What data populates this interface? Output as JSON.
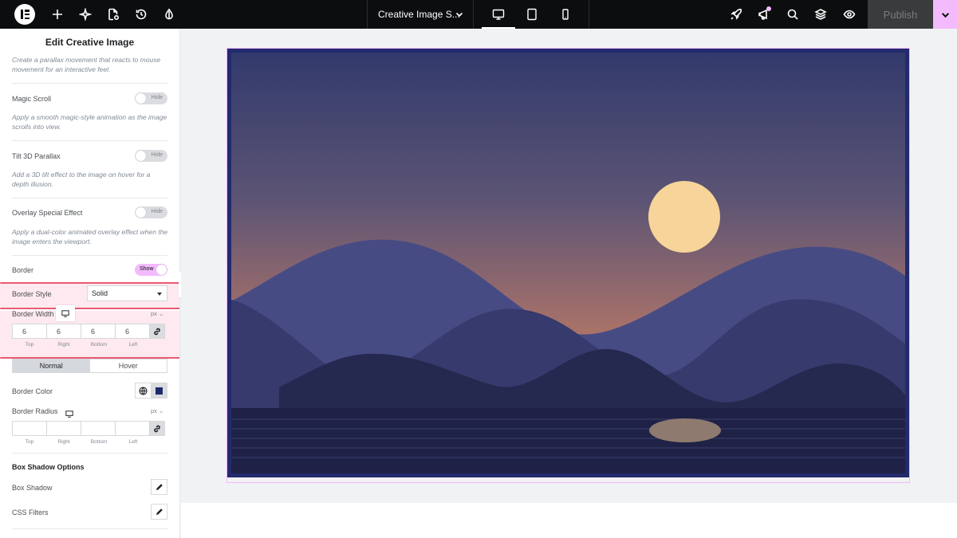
{
  "topbar": {
    "document_title": "Creative Image S...",
    "publish_label": "Publish",
    "left_icons": [
      "elementor-logo-icon",
      "add-icon",
      "ai-sparkle-icon",
      "page-settings-icon",
      "history-icon",
      "site-style-icon"
    ],
    "devices": [
      "desktop-icon",
      "tablet-icon",
      "mobile-icon"
    ],
    "active_device": "desktop",
    "right_icons": [
      "rocket-icon",
      "announcements-icon",
      "search-icon",
      "structure-layers-icon",
      "preview-eye-icon"
    ]
  },
  "panel": {
    "title": "Edit Creative Image",
    "top_desc": "Create a parallax movement that reacts to mouse movement for an interactive feel.",
    "magic_scroll": {
      "label": "Magic Scroll",
      "toggle": "Hide",
      "desc": "Apply a smooth magic-style animation as the image scrolls into view."
    },
    "tilt": {
      "label": "Tilt 3D Parallax",
      "toggle": "Hide",
      "desc": "Add a 3D tilt effect to the image on hover for a depth illusion."
    },
    "overlay": {
      "label": "Overlay Special Effect",
      "toggle": "Hide",
      "desc": "Apply a dual-color animated overlay effect when the image enters the viewport."
    },
    "border": {
      "label": "Border",
      "toggle": "Show"
    },
    "border_style": {
      "label": "Border Style",
      "value": "Solid"
    },
    "border_width": {
      "label": "Border Width",
      "unit": "px",
      "top": "6",
      "right": "6",
      "bottom": "6",
      "left": "6"
    },
    "dim_labels": {
      "top": "Top",
      "right": "Right",
      "bottom": "Bottom",
      "left": "Left"
    },
    "state_tabs": {
      "normal": "Normal",
      "hover": "Hover",
      "active": "Normal"
    },
    "border_color": {
      "label": "Border Color",
      "value": "#1e2a6b"
    },
    "border_radius": {
      "label": "Border Radius",
      "unit": "px",
      "top": "",
      "right": "",
      "bottom": "",
      "left": ""
    },
    "box_shadow_options": {
      "title": "Box Shadow Options",
      "box_shadow": "Box Shadow",
      "css_filters": "CSS Filters"
    }
  },
  "colors": {
    "accent_pink": "#f3bafd",
    "highlight_bg": "#fde9ef",
    "highlight_line": "#e95a73",
    "image_border": "#232a6e"
  }
}
